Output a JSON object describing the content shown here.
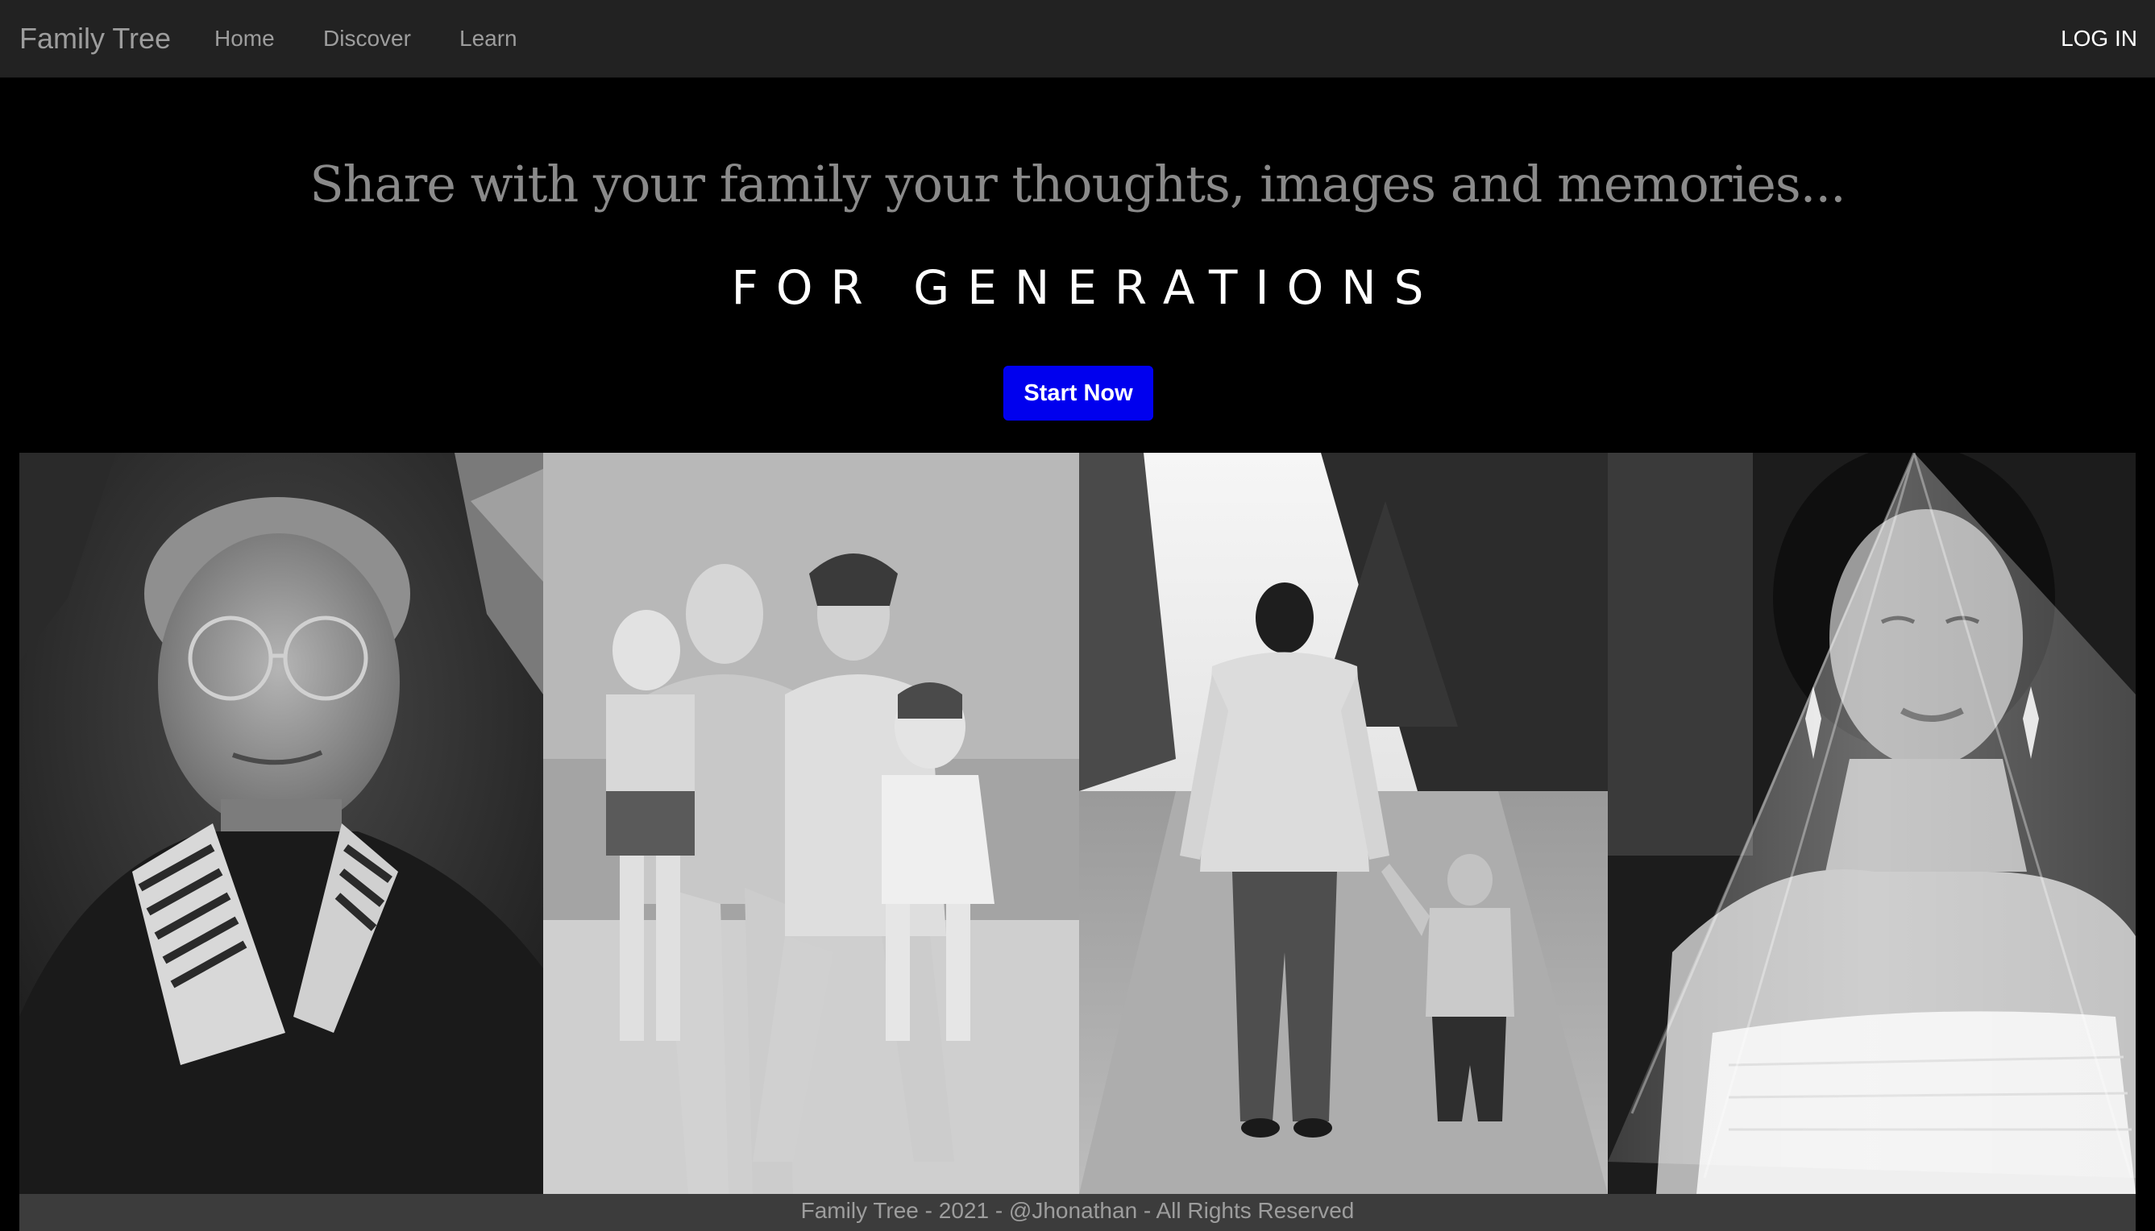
{
  "navbar": {
    "brand": "Family Tree",
    "links": [
      {
        "label": "Home"
      },
      {
        "label": "Discover"
      },
      {
        "label": "Learn"
      }
    ],
    "login_label": "LOG IN"
  },
  "hero": {
    "tagline": "Share with your family your thoughts, images and memories...",
    "headline": "FOR GENERATIONS",
    "cta_label": "Start Now"
  },
  "gallery": {
    "photos": [
      {
        "name": "elderly-woman-photo"
      },
      {
        "name": "family-beach-photo"
      },
      {
        "name": "father-son-walking-photo"
      },
      {
        "name": "bride-veil-photo"
      }
    ]
  },
  "footer": {
    "text": "Family Tree - 2021 - @Jhonathan - All Rights Reserved"
  },
  "colors": {
    "navbar_bg": "#222222",
    "cta_bg": "#0000ee",
    "footer_bg": "#3c3c3c"
  }
}
